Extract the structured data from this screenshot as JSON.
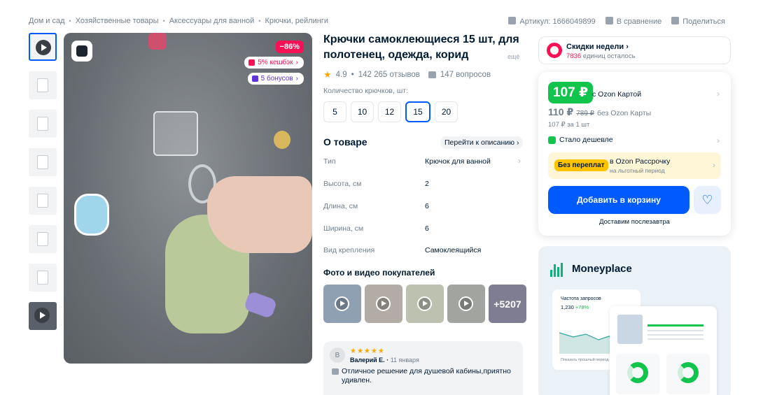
{
  "breadcrumbs": [
    "Дом и сад",
    "Хозяйственные товары",
    "Аксессуары для ванной",
    "Крючки, рейлинги"
  ],
  "meta": {
    "article": "Артикул: 1666049899",
    "compare": "В сравнение",
    "share": "Поделиться"
  },
  "gallery": {
    "discount": "−86%",
    "cashback": "5% кешбэк",
    "bonus": "5 бонусов"
  },
  "product": {
    "title": "Крючки самоклеющиеся 15 шт, для полотенец, одежда, корид",
    "more": "ещё",
    "rating": "4.9",
    "reviews": "142 265 отзывов",
    "questions": "147 вопросов",
    "qty_label": "Количество крючков, шт:",
    "qty_options": [
      "5",
      "10",
      "12",
      "15",
      "20"
    ]
  },
  "about": {
    "title": "О товаре",
    "goto": "Перейти к описанию",
    "specs": [
      {
        "k": "Тип",
        "v": "Крючок для ванной"
      },
      {
        "k": "Высота, см",
        "v": "2"
      },
      {
        "k": "Длина, см",
        "v": "6"
      },
      {
        "k": "Ширина, см",
        "v": "6"
      },
      {
        "k": "Вид крепления",
        "v": "Самоклеящийся"
      }
    ]
  },
  "photos": {
    "title": "Фото и видео покупателей",
    "more": "+5207"
  },
  "review": {
    "initial": "В",
    "stars": "★★★★★",
    "author": "Валерий Е.",
    "date": "11 января",
    "text": "Отличное решение для душевой кабины,приятно удивлен."
  },
  "deals": {
    "title": "Скидки недели",
    "left_count": "7836",
    "left_text": "единиц осталось"
  },
  "price": {
    "ozon": "107 ₽",
    "ozon_label": "с Ozon Картой",
    "regular": "110 ₽",
    "old": "789 ₽",
    "regular_label": "без Ozon Карты",
    "unit": "107 ₽ за 1 шт",
    "cheaper": "Стало дешевле",
    "installment_tag": "Без переплат",
    "installment_a": "в Ozon Рассрочку",
    "installment_b": "на льготный период",
    "add_to_cart": "Добавить в корзину",
    "delivery": "Доставим послезавтра"
  },
  "moneyplace": {
    "name": "Moneyplace",
    "card_title": "Частота запросов",
    "card_value": "1,230",
    "card_delta": "+78%",
    "card_check": "Показать прошлый период"
  },
  "colors": {
    "accent": "#005bff",
    "discount": "#f91155",
    "ozon_price": "#10c44c",
    "bonus": "#5e34d9"
  }
}
